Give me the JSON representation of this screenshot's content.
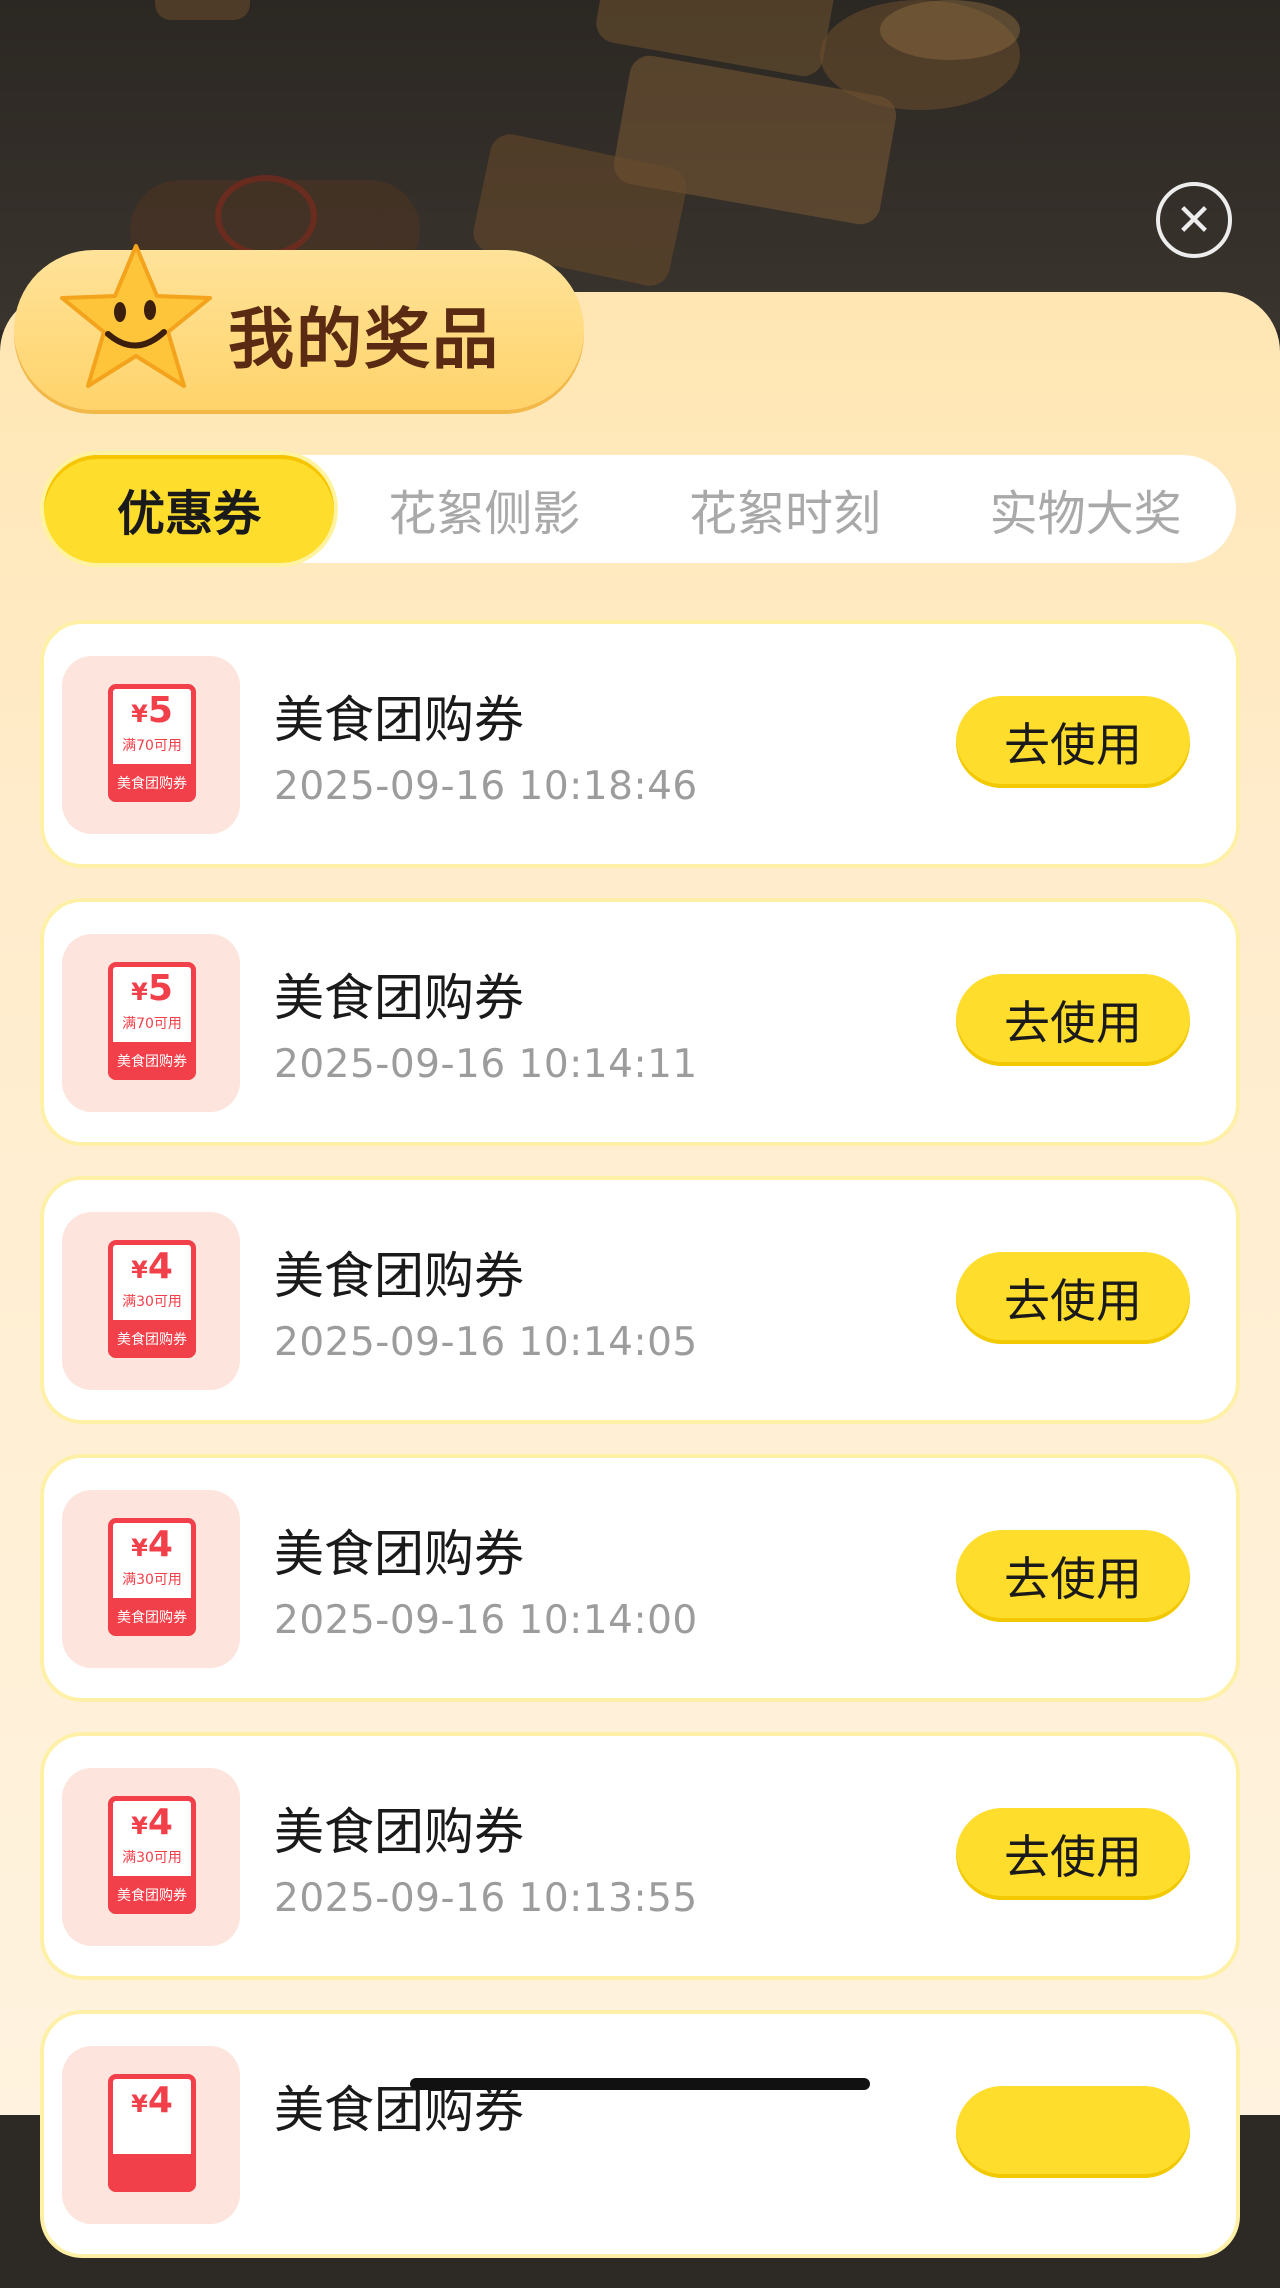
{
  "header": {
    "title": "我的奖品",
    "close_icon": "close-icon"
  },
  "tabs": [
    {
      "label": "优惠券",
      "active": true
    },
    {
      "label": "花絮侧影",
      "active": false
    },
    {
      "label": "花絮时刻",
      "active": false
    },
    {
      "label": "实物大奖",
      "active": false
    }
  ],
  "coupons": [
    {
      "title": "美食团购券",
      "time": "2025-09-16 10:18:46",
      "amount": "5",
      "currency": "¥",
      "condition": "满70可用",
      "badge_label": "美食团购券",
      "button": "去使用"
    },
    {
      "title": "美食团购券",
      "time": "2025-09-16 10:14:11",
      "amount": "5",
      "currency": "¥",
      "condition": "满70可用",
      "badge_label": "美食团购券",
      "button": "去使用"
    },
    {
      "title": "美食团购券",
      "time": "2025-09-16 10:14:05",
      "amount": "4",
      "currency": "¥",
      "condition": "满30可用",
      "badge_label": "美食团购券",
      "button": "去使用"
    },
    {
      "title": "美食团购券",
      "time": "2025-09-16 10:14:00",
      "amount": "4",
      "currency": "¥",
      "condition": "满30可用",
      "badge_label": "美食团购券",
      "button": "去使用"
    },
    {
      "title": "美食团购券",
      "time": "2025-09-16 10:13:55",
      "amount": "4",
      "currency": "¥",
      "condition": "满30可用",
      "badge_label": "美食团购券",
      "button": "去使用"
    },
    {
      "title": "美食团购券",
      "time": "",
      "amount": "4",
      "currency": "¥",
      "condition": "",
      "badge_label": "",
      "button": ""
    }
  ],
  "colors": {
    "accent_yellow": "#ffdd2c",
    "coupon_red": "#f2404a",
    "title_brown": "#5a2a12",
    "muted_gray": "#9c9c9c"
  }
}
